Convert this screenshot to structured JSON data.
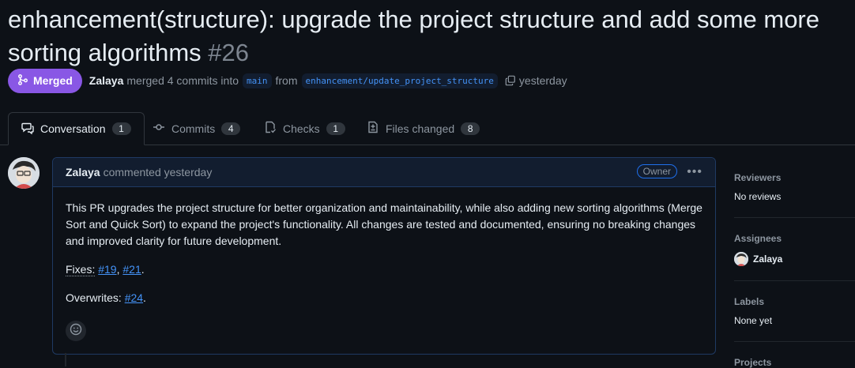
{
  "pr": {
    "title": "enhancement(structure): upgrade the project structure and add some more sorting algorithms",
    "number": "#26",
    "status": "Merged",
    "author": "Zalaya",
    "merge_text": "merged 4 commits into",
    "base_branch": "main",
    "from_text": "from",
    "head_branch": "enhancement/update_project_structure",
    "time": "yesterday"
  },
  "tabs": [
    {
      "label": "Conversation",
      "count": "1",
      "icon": "comment-icon"
    },
    {
      "label": "Commits",
      "count": "4",
      "icon": "commit-icon"
    },
    {
      "label": "Checks",
      "count": "1",
      "icon": "checklist-icon"
    },
    {
      "label": "Files changed",
      "count": "8",
      "icon": "file-diff-icon"
    }
  ],
  "comment": {
    "author": "Zalaya",
    "action": "commented yesterday",
    "role": "Owner",
    "body": "This PR upgrades the project structure for better organization and maintainability, while also adding new sorting algorithms (Merge Sort and Quick Sort) to expand the project's functionality. All changes are tested and documented, ensuring no breaking changes and improved clarity for future development.",
    "fixes_label": "Fixes:",
    "fixes_links": [
      "#19",
      "#21"
    ],
    "overwrites_label": "Overwrites:",
    "overwrites_link": "#24"
  },
  "sidebar": {
    "reviewers_heading": "Reviewers",
    "reviewers_value": "No reviews",
    "assignees_heading": "Assignees",
    "assignee": "Zalaya",
    "labels_heading": "Labels",
    "labels_value": "None yet",
    "projects_heading": "Projects"
  },
  "colors": {
    "background": "#0d1117",
    "merged": "#8957e5",
    "link": "#4493f8",
    "comment_border": "#1f3a63"
  }
}
